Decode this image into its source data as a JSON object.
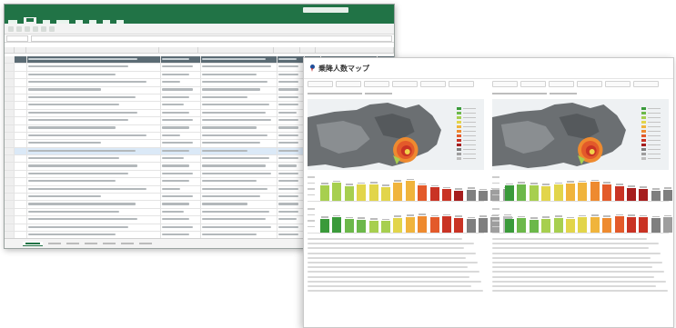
{
  "dashboard": {
    "title": "乗降人数マップ"
  },
  "colors": {
    "excel_green": "#217346",
    "header_slate": "#5b6b74",
    "legend_scale": [
      "#3a9a3a",
      "#6cb84a",
      "#a7cf4f",
      "#e2d54a",
      "#f0b43c",
      "#ee8a2f",
      "#e35a2a",
      "#c93324",
      "#a61d1d",
      "#7f7f7f",
      "#9e9e9e",
      "#bdbdbd"
    ]
  },
  "chart_data": [
    {
      "type": "bar",
      "panel": "left-top",
      "values": [
        62,
        70,
        58,
        64,
        66,
        55,
        72,
        78,
        60,
        52,
        45,
        40,
        44,
        38,
        42,
        46
      ],
      "colors_index": [
        2,
        2,
        2,
        3,
        3,
        3,
        4,
        4,
        6,
        7,
        7,
        8,
        9,
        9,
        10,
        10
      ]
    },
    {
      "type": "bar",
      "panel": "left-bottom",
      "values": [
        55,
        60,
        52,
        50,
        48,
        46,
        58,
        62,
        66,
        60,
        64,
        57,
        52,
        58,
        60,
        63
      ],
      "colors_index": [
        0,
        0,
        1,
        1,
        2,
        2,
        3,
        4,
        5,
        6,
        7,
        7,
        9,
        9,
        10,
        11
      ]
    },
    {
      "type": "bar",
      "panel": "right-top",
      "values": [
        60,
        66,
        62,
        58,
        64,
        68,
        70,
        74,
        66,
        58,
        50,
        48,
        40,
        44,
        46,
        50
      ],
      "colors_index": [
        0,
        1,
        2,
        3,
        3,
        4,
        4,
        5,
        6,
        7,
        8,
        8,
        9,
        9,
        10,
        10
      ]
    },
    {
      "type": "bar",
      "panel": "right-bottom",
      "values": [
        52,
        56,
        50,
        54,
        58,
        52,
        60,
        62,
        58,
        64,
        62,
        60,
        56,
        60,
        62,
        64
      ],
      "colors_index": [
        0,
        1,
        1,
        2,
        2,
        3,
        3,
        4,
        5,
        6,
        7,
        7,
        9,
        10,
        10,
        11
      ]
    }
  ]
}
